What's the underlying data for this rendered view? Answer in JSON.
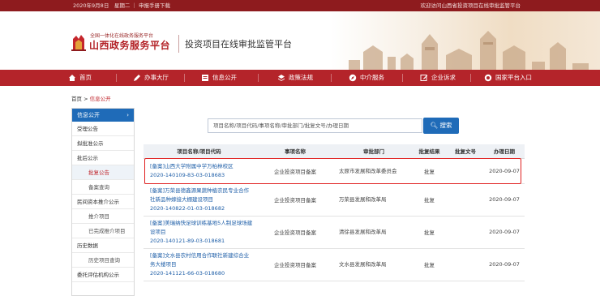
{
  "topbar": {
    "left_text": "2020年9月8日　星期二 ｜ 申报手册下载",
    "right_text": "欢迎访问山西省投资项目在线审批监管平台"
  },
  "header": {
    "logo_line1": "全国一体化在线政务服务平台",
    "logo_line2": "山西政务服务平台",
    "subtitle": "投资项目在线审批监管平台"
  },
  "nav": {
    "items": [
      {
        "label": "首页",
        "icon": "home-icon"
      },
      {
        "label": "办事大厅",
        "icon": "pen-icon"
      },
      {
        "label": "信息公开",
        "icon": "document-icon"
      },
      {
        "label": "政策法规",
        "icon": "layers-icon"
      },
      {
        "label": "中介服务",
        "icon": "compass-icon"
      },
      {
        "label": "企业诉求",
        "icon": "edit-icon"
      },
      {
        "label": "国家平台入口",
        "icon": "globe-icon"
      }
    ]
  },
  "breadcrumb": {
    "home": "首页",
    "sep": ">",
    "current": "信息公开"
  },
  "sidebar": {
    "header": "信息公开",
    "items": [
      {
        "label": "受理公告",
        "sub": false,
        "active": false
      },
      {
        "label": "拟批准公示",
        "sub": false,
        "active": false
      },
      {
        "label": "批后公示",
        "sub": false,
        "active": false
      },
      {
        "label": "批复公告",
        "sub": true,
        "active": true
      },
      {
        "label": "备案查询",
        "sub": true,
        "active": false
      },
      {
        "label": "民间资本推介公示",
        "sub": false,
        "active": false
      },
      {
        "label": "推介项目",
        "sub": true,
        "active": false
      },
      {
        "label": "已完成推介项目",
        "sub": true,
        "active": false
      },
      {
        "label": "历史数据",
        "sub": false,
        "active": false
      },
      {
        "label": "历史项目查询",
        "sub": true,
        "active": false
      },
      {
        "label": "委托评估机构公示",
        "sub": false,
        "active": false
      }
    ]
  },
  "search": {
    "placeholder": "项目名称/项目代码/事项名称/审批部门/批复文号/办理日期",
    "button": "搜索"
  },
  "table": {
    "headers": [
      "项目名称/项目代码",
      "事项名称",
      "审批部门",
      "批复结果",
      "批复文号",
      "办理日期"
    ],
    "rows": [
      {
        "name": "[备案]山西大学附属中学万柏林校区",
        "code": "2020-140109-83-03-018683",
        "matter": "企业投资项目备案",
        "dept": "太原市发展和改革委员会",
        "result": "批复",
        "doc_no": "",
        "date": "2020-09-07"
      },
      {
        "name": "[备案]万荣县德鑫源果蔬种植农民专业合作社新品种嫁接大棚建设项目",
        "code": "2020-140822-01-03-018682",
        "matter": "企业投资项目备案",
        "dept": "万荣县发展和改革局",
        "result": "批复",
        "doc_no": "",
        "date": "2020-09-07"
      },
      {
        "name": "[备案]美瑞纳快足球训练基地5人制足球场建设项目",
        "code": "2020-140121-89-03-018681",
        "matter": "企业投资项目备案",
        "dept": "清徐县发展和改革局",
        "result": "批复",
        "doc_no": "",
        "date": "2020-09-07"
      },
      {
        "name": "[备案]文水县农村信用合作联社新建综合业务大楼项目",
        "code": "2020-141121-66-03-018680",
        "matter": "企业投资项目备案",
        "dept": "文水县发展和改革局",
        "result": "批复",
        "doc_no": "",
        "date": "2020-09-07"
      }
    ]
  },
  "colors": {
    "brand_red": "#b4242a",
    "topbar_red": "#8e1b1e",
    "link_blue": "#1f5fa8",
    "button_blue": "#1f6bb8",
    "highlight": "#e02020"
  }
}
